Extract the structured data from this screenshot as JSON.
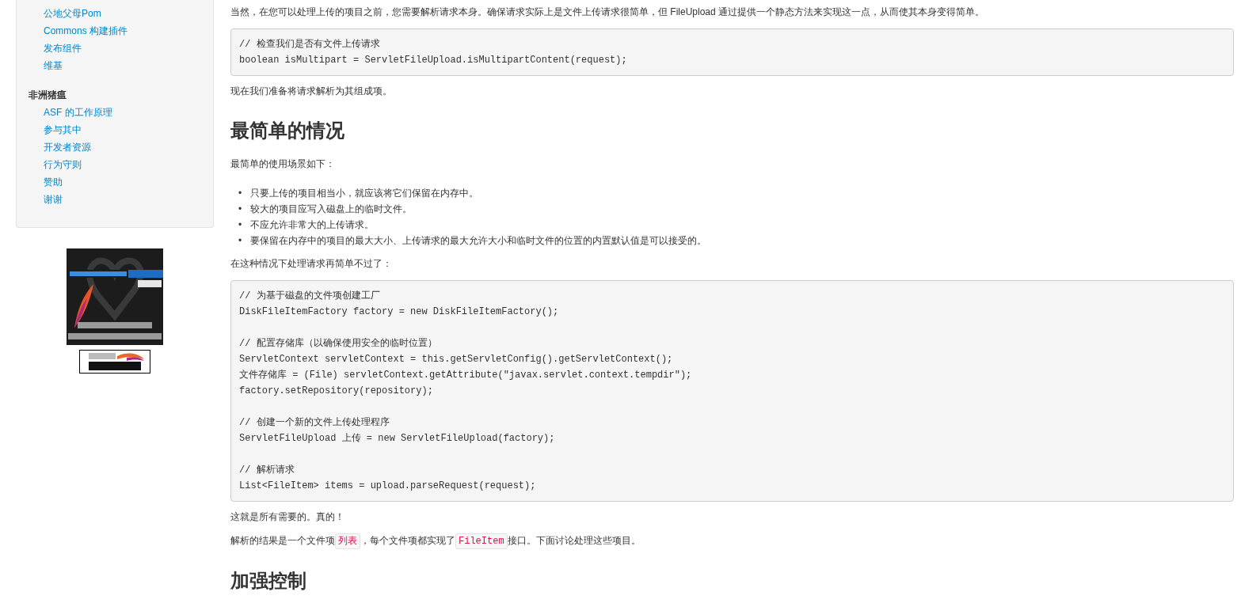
{
  "sidebar": {
    "groups": [
      {
        "items": [
          "公地父母Pom",
          "Commons 构建插件",
          "发布组件",
          "维基"
        ]
      },
      {
        "header": "非洲猪瘟",
        "items": [
          "ASF 的工作原理",
          "参与其中",
          "开发者资源",
          "行为守则",
          "赞助",
          "谢谢"
        ]
      }
    ]
  },
  "content": [
    {
      "kind": "paragraph",
      "segments": [
        {
          "kind": "text",
          "text": "当然，在您可以处理上传的项目之前，您需要解析请求本身。确保请求实际上是文件上传请求很简单，但 FileUpload 通过提供一个静态方法来实现这一点，从而使其本身变得简单。"
        }
      ]
    },
    {
      "kind": "code",
      "groups": [
        [
          "// 检查我们是否有文件上传请求",
          "boolean isMultipart = ServletFileUpload.isMultipartContent(request);"
        ]
      ]
    },
    {
      "kind": "paragraph",
      "segments": [
        {
          "kind": "text",
          "text": "现在我们准备将请求解析为其组成项。"
        }
      ]
    },
    {
      "kind": "heading",
      "text": "最简单的情况"
    },
    {
      "kind": "paragraph",
      "segments": [
        {
          "kind": "text",
          "text": "最简单的使用场景如下："
        }
      ]
    },
    {
      "kind": "list",
      "marker": "•",
      "items": [
        "只要上传的项目相当小，就应该将它们保留在内存中。",
        "较大的项目应写入磁盘上的临时文件。",
        "不应允许非常大的上传请求。",
        "要保留在内存中的项目的最大大小、上传请求的最大允许大小和临时文件的位置的内置默认值是可以接受的。"
      ]
    },
    {
      "kind": "paragraph",
      "segments": [
        {
          "kind": "text",
          "text": "在这种情况下处理请求再简单不过了："
        }
      ]
    },
    {
      "kind": "code",
      "groups": [
        [
          "// 为基于磁盘的文件项创建工厂",
          "DiskFileItemFactory factory = new DiskFileItemFactory();"
        ],
        [
          "// 配置存储库（以确保使用安全的临时位置）",
          "ServletContext servletContext = this.getServletConfig().getServletContext();",
          "文件存储库 = (File) servletContext.getAttribute(\"javax.servlet.context.tempdir\");",
          "factory.setRepository(repository);"
        ],
        [
          "// 创建一个新的文件上传处理程序",
          "ServletFileUpload 上传 = new ServletFileUpload(factory);"
        ],
        [
          "// 解析请求",
          "List<FileItem> items = upload.parseRequest(request);"
        ]
      ]
    },
    {
      "kind": "paragraph",
      "segments": [
        {
          "kind": "text",
          "text": "这就是所有需要的。真的！"
        }
      ]
    },
    {
      "kind": "paragraph",
      "segments": [
        {
          "kind": "text",
          "text": "解析的结果是一个文件项"
        },
        {
          "kind": "code",
          "text": "列表"
        },
        {
          "kind": "text",
          "text": "，每个文件项都实现了"
        },
        {
          "kind": "code",
          "text": "FileItem"
        },
        {
          "kind": "text",
          "text": "接口。下面讨论处理这些项目。"
        }
      ]
    },
    {
      "kind": "heading",
      "text": "加强控制"
    }
  ]
}
